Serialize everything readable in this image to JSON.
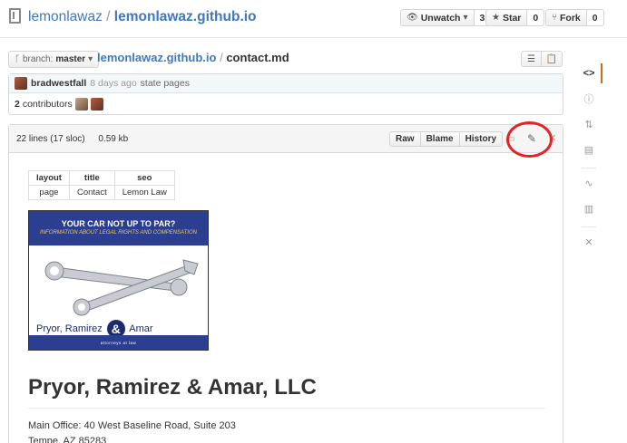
{
  "repo": {
    "owner": "lemonlawaz",
    "separator": "/",
    "name": "lemonlawaz.github.io"
  },
  "actions": {
    "watch": {
      "label": "Unwatch",
      "count": "3"
    },
    "star": {
      "label": "Star",
      "count": "0"
    },
    "fork": {
      "label": "Fork",
      "count": "0"
    }
  },
  "sidebar": {
    "items": [
      {
        "name": "code-icon",
        "glyph": "<>"
      },
      {
        "name": "issues-icon",
        "glyph": "ⓘ"
      },
      {
        "name": "pull-requests-icon",
        "glyph": "⇅"
      },
      {
        "name": "wiki-icon",
        "glyph": "▤"
      },
      {
        "name": "pulse-icon",
        "glyph": "∿"
      },
      {
        "name": "graphs-icon",
        "glyph": "▥"
      },
      {
        "name": "settings-icon",
        "glyph": "✕"
      }
    ]
  },
  "branch": {
    "prefix": "branch:",
    "name": "master"
  },
  "breadcrumb": {
    "repo": "lemonlawaz.github.io",
    "separator": "/",
    "file": "contact.md"
  },
  "commit": {
    "author": "bradwestfall",
    "time": "8 days ago",
    "message": "state pages",
    "contributors_count": "2",
    "contributors_label": "contributors"
  },
  "file": {
    "lines": "22 lines (17 sloc)",
    "size": "0.59 kb",
    "buttons": {
      "raw": "Raw",
      "blame": "Blame",
      "history": "History"
    }
  },
  "markdown": {
    "table": {
      "headers": [
        "layout",
        "title",
        "seo"
      ],
      "row": [
        "page",
        "Contact",
        "Lemon Law"
      ]
    },
    "banner": {
      "headline": "YOUR CAR NOT UP TO PAR?",
      "subheadline": "INFORMATION ABOUT LEGAL RIGHTS AND COMPENSATION",
      "firm_part1": "Pryor, Ramirez",
      "firm_amp": "&",
      "firm_part2": "Amar",
      "tagline": "attorneys at law"
    },
    "heading": "Pryor, Ramirez & Amar, LLC",
    "address_line1": "Main Office: 40 West Baseline Road, Suite 203",
    "address_line2": "Tempe, AZ 85283"
  },
  "colors": {
    "link": "#4078c0",
    "highlight_circle": "#e2232a",
    "banner_blue": "#2c3e8f",
    "selected_tab": "#d26911"
  }
}
